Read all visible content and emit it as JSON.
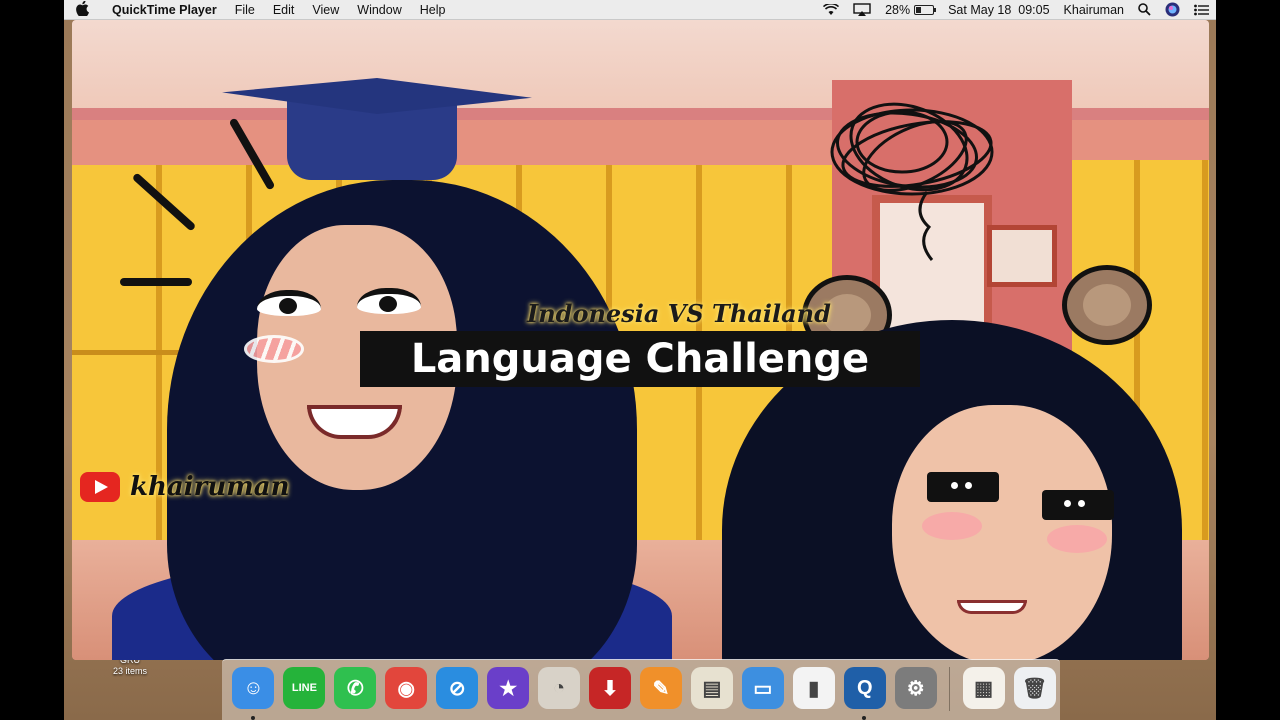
{
  "menubar": {
    "apple_icon": "apple-icon",
    "app_name": "QuickTime Player",
    "menus": [
      "File",
      "Edit",
      "View",
      "Window",
      "Help"
    ],
    "status": {
      "wifi_icon": "wifi-icon",
      "airplay_icon": "airplay-icon",
      "battery_percent": "28%",
      "battery_level": 0.28,
      "datetime": "Sat May 18  09:05",
      "user": "Khairuman",
      "search_icon": "spotlight-search-icon",
      "siri_icon": "siri-icon",
      "notification_icon": "notification-center-icon"
    }
  },
  "desktop": {
    "folder_name": "GRU",
    "folder_count": "23 items"
  },
  "video": {
    "subtitle": "Indonesia VS Thailand",
    "title": "Language Challenge",
    "channel": "khairuman",
    "channel_icon": "youtube-icon"
  },
  "dock": {
    "apps": [
      {
        "name": "Finder",
        "icon": "finder-icon",
        "color": "#3a8ee6",
        "glyph": "☺",
        "running": true
      },
      {
        "name": "LINE",
        "icon": "line-icon",
        "color": "#25b33a",
        "glyph": "LINE",
        "running": false
      },
      {
        "name": "WhatsApp",
        "icon": "whatsapp-icon",
        "color": "#2fc04f",
        "glyph": "✆",
        "running": false
      },
      {
        "name": "Chrome",
        "icon": "chrome-icon",
        "color": "#e2463c",
        "glyph": "◉",
        "running": false
      },
      {
        "name": "Safari",
        "icon": "safari-icon",
        "color": "#2a8de0",
        "glyph": "⊘",
        "running": false
      },
      {
        "name": "iMovie",
        "icon": "imovie-icon",
        "color": "#6a3fc9",
        "glyph": "★",
        "running": false
      },
      {
        "name": "Screen Recorder",
        "icon": "screen-recorder-icon",
        "color": "#d8d2c8",
        "glyph": "◔",
        "running": false
      },
      {
        "name": "Downloader",
        "icon": "downloader-icon",
        "color": "#c62626",
        "glyph": "⬇",
        "running": false
      },
      {
        "name": "Pages",
        "icon": "pages-icon",
        "color": "#f0902a",
        "glyph": "✎",
        "running": false
      },
      {
        "name": "Preview",
        "icon": "preview-icon",
        "color": "#e7e1d0",
        "glyph": "▤",
        "running": false
      },
      {
        "name": "Keynote",
        "icon": "keynote-icon",
        "color": "#3d8fe0",
        "glyph": "▭",
        "running": false
      },
      {
        "name": "Numbers",
        "icon": "numbers-icon",
        "color": "#f3f3f3",
        "glyph": "▮",
        "running": false
      },
      {
        "name": "QuickTime Player",
        "icon": "quicktime-icon",
        "color": "#1f5fa8",
        "glyph": "Q",
        "running": true
      },
      {
        "name": "System Preferences",
        "icon": "system-preferences-icon",
        "color": "#7c7c7c",
        "glyph": "⚙",
        "running": false
      }
    ],
    "extras": [
      {
        "name": "Preview Document",
        "icon": "document-stack-icon",
        "color": "#f4f1ea",
        "glyph": "▦"
      },
      {
        "name": "Trash",
        "icon": "trash-icon",
        "color": "#eef0f2",
        "glyph": "🗑"
      }
    ]
  }
}
